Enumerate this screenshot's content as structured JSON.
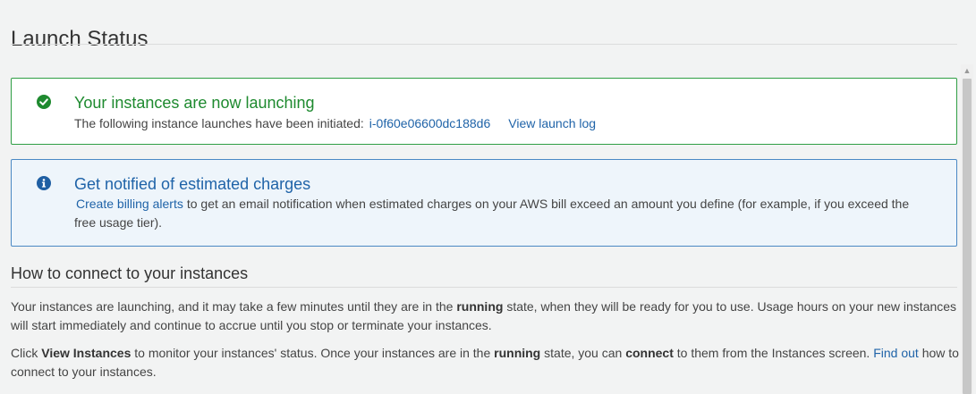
{
  "page": {
    "title": "Launch Status"
  },
  "success_alert": {
    "title": "Your instances are now launching",
    "body_prefix": "The following instance launches have been initiated:",
    "instance_id": "i-0f60e06600dc188d6",
    "view_log_label": "View launch log",
    "icon": "check-circle-icon",
    "color": "#1e8a2f"
  },
  "info_alert": {
    "title": "Get notified of estimated charges",
    "link_label": "Create billing alerts",
    "body_suffix": "to get an email notification when estimated charges on your AWS bill exceed an amount you define (for example, if you exceed the free usage tier).",
    "icon": "info-circle-icon",
    "color": "#1f63a8"
  },
  "connect_section": {
    "heading": "How to connect to your instances",
    "para1_a": "Your instances are launching, and it may take a few minutes until they are in the ",
    "para1_bold": "running",
    "para1_b": " state, when they will be ready for you to use. Usage hours on your new instances will start immediately and continue to accrue until you stop or terminate your instances.",
    "para2_a": "Click ",
    "para2_bold1": "View Instances",
    "para2_b": " to monitor your instances' status. Once your instances are in the ",
    "para2_bold2": "running",
    "para2_c": " state, you can ",
    "para2_bold3": "connect",
    "para2_d": " to them from the Instances screen. ",
    "find_out_label": "Find out",
    "para2_e": " how to connect to your instances."
  }
}
